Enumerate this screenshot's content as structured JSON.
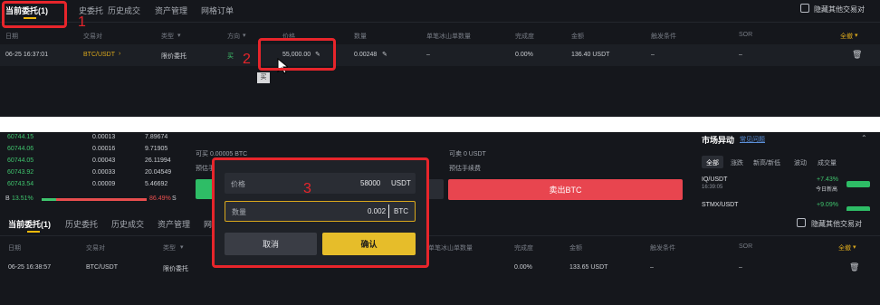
{
  "top": {
    "tabs": [
      {
        "label": "当前委托(1)"
      },
      {
        "label": "史委托"
      },
      {
        "label": "历史成交"
      },
      {
        "label": "资产管理"
      },
      {
        "label": "网格订单"
      }
    ],
    "hide_pairs_label": "隐藏其他交易对",
    "columns": [
      "日期",
      "交易对",
      "类型",
      "方向",
      "价格",
      "数量",
      "单笔冰山单数量",
      "完成度",
      "金额",
      "触发条件",
      "SOR"
    ],
    "all_cancel": "全撤",
    "row": {
      "date": "06-25 16:37:01",
      "pair": "BTC/USDT",
      "type": "限价委托",
      "side": "买",
      "price": "55,000.00",
      "qty": "0.00248",
      "iceberg": "–",
      "progress": "0.00%",
      "amount": "136.40 USDT",
      "trigger": "–",
      "sor": "–"
    },
    "tooltip": "买",
    "annotations": {
      "n1": "1",
      "n2": "2"
    }
  },
  "orderbook": {
    "rows": [
      {
        "price": "60744.15",
        "qty": "0.00013",
        "total": "7.89674"
      },
      {
        "price": "60744.06",
        "qty": "0.00016",
        "total": "9.71905"
      },
      {
        "price": "60744.05",
        "qty": "0.00043",
        "total": "26.11994"
      },
      {
        "price": "60743.92",
        "qty": "0.00033",
        "total": "20.04549"
      },
      {
        "price": "60743.54",
        "qty": "0.00009",
        "total": "5.46692"
      }
    ],
    "buy_label": "B",
    "buy_pct": "13.51%",
    "sell_pct": "86.49%",
    "sell_label": "S",
    "buy_ratio": 0.1351
  },
  "trade": {
    "buy_available": "可买  0.00005 BTC",
    "buy_fee": "预估手",
    "sell_available": "可卖  0 USDT",
    "sell_fee": "预估手续费",
    "sell_button": "卖出BTC"
  },
  "modal": {
    "price_label": "价格",
    "price_value": "58000",
    "price_unit": "USDT",
    "qty_label": "数量",
    "qty_value": "0.002",
    "qty_unit": "BTC",
    "cancel": "取消",
    "confirm": "确认",
    "annotation": "3"
  },
  "market": {
    "title": "市场异动",
    "link": "常见问题",
    "filters": [
      "全部",
      "涨跌",
      "新高/新低",
      "波动",
      "成交量"
    ],
    "items": [
      {
        "pair": "IQ/USDT",
        "time": "16:39:05",
        "change": "+7.43%",
        "note": "今日新高"
      },
      {
        "pair": "STMX/USDT",
        "time": "",
        "change": "+9.09%",
        "note": ""
      }
    ]
  },
  "bottom": {
    "tabs": [
      {
        "label": "当前委托(1)"
      },
      {
        "label": "历史委托"
      },
      {
        "label": "历史成交"
      },
      {
        "label": "资产管理"
      },
      {
        "label": "网"
      }
    ],
    "hide_pairs_label": "隐藏其他交易对",
    "columns": [
      "日期",
      "交易对",
      "类型",
      "单笔冰山单数量",
      "完成度",
      "金额",
      "触发条件",
      "SOR"
    ],
    "all_cancel": "全撤",
    "row": {
      "date": "06-25 16:38:57",
      "pair": "BTC/USDT",
      "type": "限价委托",
      "progress": "0.00%",
      "amount": "133.65 USDT",
      "trigger": "–",
      "sor": "–"
    }
  },
  "colors": {
    "accent_gold": "#d9a71c",
    "annotation_red": "#e7252b",
    "sell_red": "#e8454f",
    "buy_green": "#3fc46d"
  }
}
